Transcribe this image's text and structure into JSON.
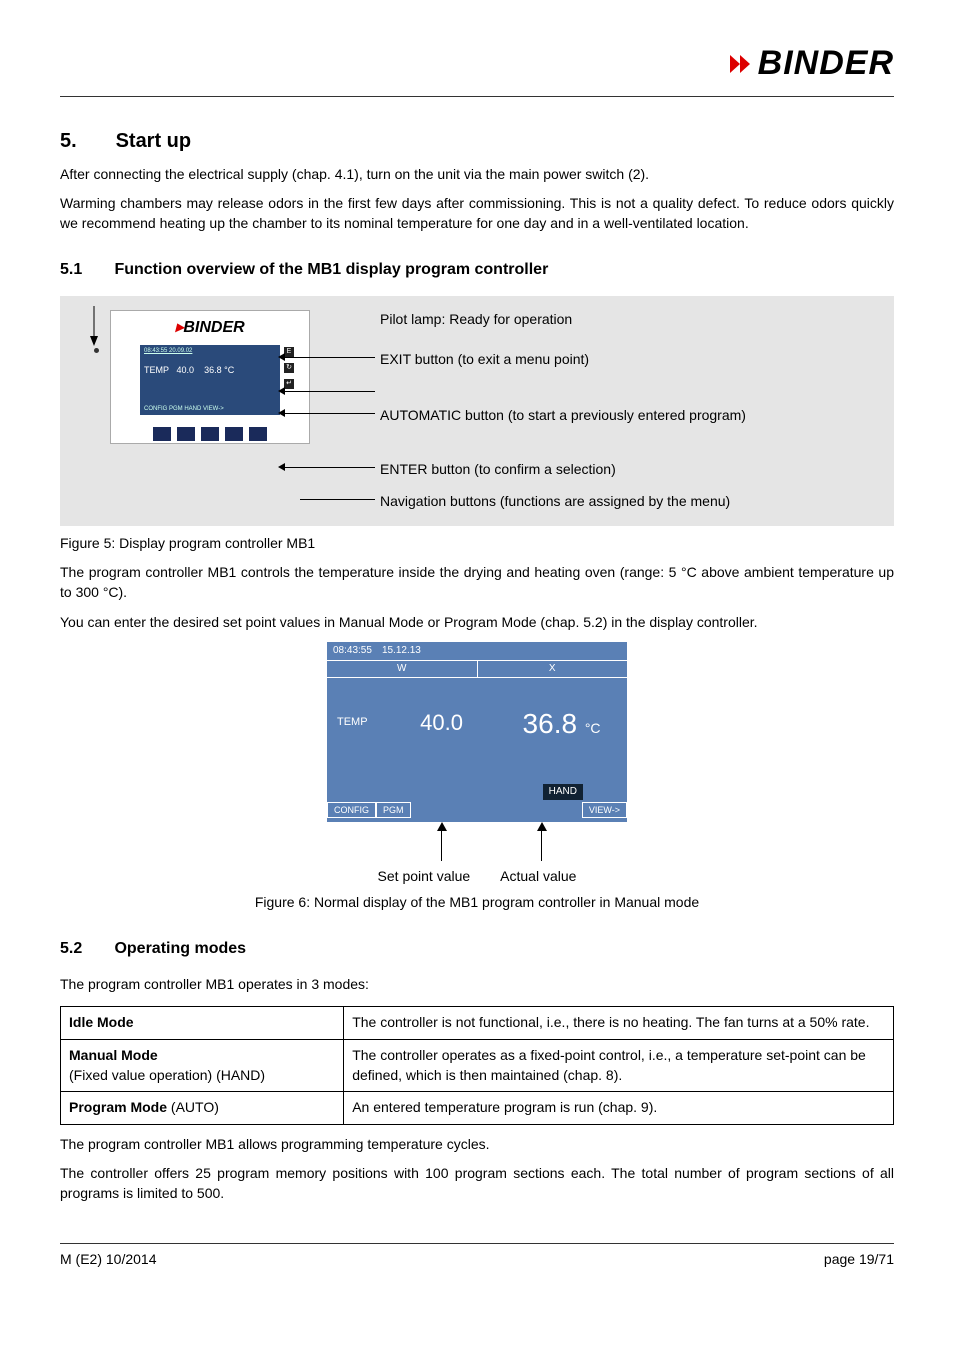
{
  "brand": "BINDER",
  "sec5": {
    "num": "5.",
    "title": "Start up",
    "p1": "After connecting the electrical supply (chap. 4.1), turn on the unit via the main power switch (2).",
    "p2": "Warming chambers may release odors in the first few days after commissioning. This is not a quality defect. To reduce odors quickly we recommend heating up the chamber to its nominal temperature for one day and in a well-ventilated location."
  },
  "sec51": {
    "num": "5.1",
    "title": "Function overview of the MB1 display program controller",
    "labels": {
      "pilot": "Pilot lamp: Ready for operation",
      "exit": "EXIT button (to exit a menu point)",
      "auto": "AUTOMATIC button (to start a previously entered program)",
      "enter": "ENTER button (to confirm a selection)",
      "nav": "Navigation buttons (functions are assigned by the menu)"
    },
    "mini": {
      "time": "08:43:55  20.09.02",
      "temp_lbl": "TEMP",
      "sp": "40.0",
      "ac": "36.8 °C",
      "bottom": "CONFIG   PGM            HAND   VIEW->"
    },
    "caption": "Figure 5: Display program controller MB1",
    "after1": "The program controller MB1 controls the temperature inside the drying and heating oven (range: 5 °C above ambient temperature up to 300 °C).",
    "after2": "You can enter the desired set point values in Manual Mode or Program Mode (chap. 5.2) in the display controller."
  },
  "fig6": {
    "time": "08:43:55",
    "date": "15.12.13",
    "w": "W",
    "x": "X",
    "temp_lbl": "TEMP",
    "sp": "40.0",
    "ac": "36.8",
    "unit": "°C",
    "hand": "HAND",
    "config": "CONFIG",
    "pgm": "PGM",
    "view": "VIEW->",
    "splabel": "Set point value",
    "aclabel": "Actual value",
    "caption": "Figure 6: Normal display of the MB1 program controller in Manual mode"
  },
  "sec52": {
    "num": "5.2",
    "title": "Operating modes",
    "intro": "The program controller MB1 operates in 3 modes:",
    "rows": [
      {
        "h_b": "Idle Mode",
        "h_r": "",
        "d": "The controller is not functional, i.e., there is no heating. The fan turns at a 50% rate."
      },
      {
        "h_b": "Manual Mode",
        "h_r": "(Fixed value operation) (HAND)",
        "d": "The controller operates as a fixed-point control, i.e., a temperature set-point can be defined, which is then maintained (chap. 8)."
      },
      {
        "h_b": "Program Mode",
        "h_r": " (AUTO)",
        "d": "An entered temperature program is run (chap. 9)."
      }
    ],
    "after1": "The program controller MB1 allows programming temperature cycles.",
    "after2": "The controller offers 25 program memory positions with 100 program sections each. The total number of program sections of all programs is limited to 500."
  },
  "footer": {
    "left": "M (E2) 10/2014",
    "right": "page 19/71"
  }
}
